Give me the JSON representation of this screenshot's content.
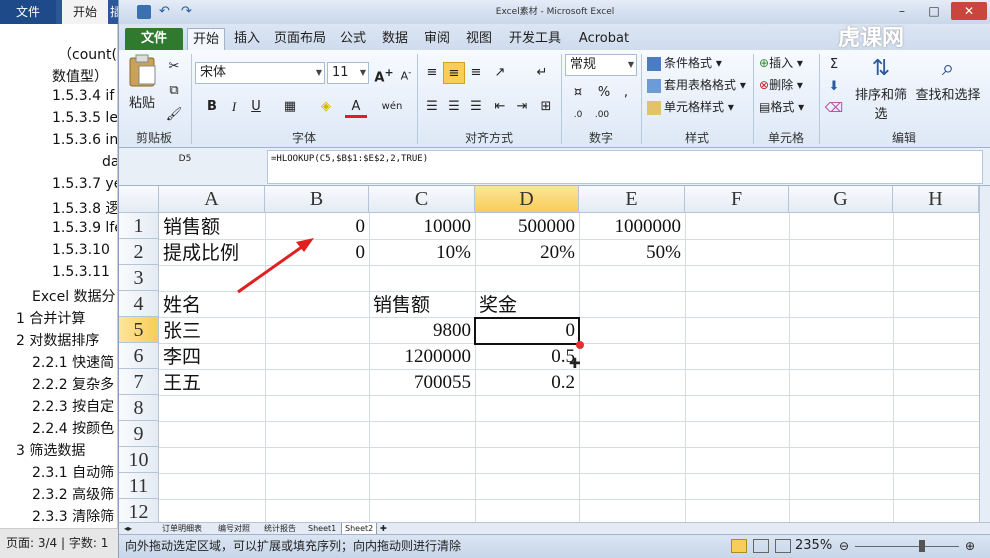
{
  "word": {
    "tabs": [
      "文件",
      "开始",
      "插"
    ],
    "nav": [
      "（count(",
      "数值型）",
      "1.5.3.4 if",
      "1.5.3.5 le",
      "1.5.3.6 in",
      "da",
      "1.5.3.7 ye",
      "1.5.3.8 逻",
      "1.5.3.9 lfe",
      "1.5.3.10",
      "1.5.3.11",
      "Excel 数据分",
      "1    合并计算",
      "2    对数据排序",
      "2.2.1 快速简",
      "2.2.2 复杂多",
      "2.2.3 按自定",
      "2.2.4 按颜色",
      "3    筛选数据",
      "2.3.1 自动筛",
      "2.3.2 高级筛",
      "2.3.3 清除筛"
    ],
    "status": "页面: 3/4 | 字数: 1"
  },
  "excel": {
    "title": "Excel素材 - Microsoft Excel",
    "tabs": [
      "文件",
      "开始",
      "插入",
      "页面布局",
      "公式",
      "数据",
      "审阅",
      "视图",
      "开发工具",
      "Acrobat"
    ],
    "ribbon": {
      "paste": "粘贴",
      "clipboard": "剪贴板",
      "font_name": "宋体",
      "font_size": "11",
      "font_group": "字体",
      "align_group": "对齐方式",
      "number_format": "常规",
      "number_group": "数字",
      "cond_format": "条件格式",
      "table_format": "套用表格格式",
      "cell_style": "单元格样式",
      "style_group": "样式",
      "insert": "插入",
      "delete": "删除",
      "format": "格式",
      "cells_group": "单元格",
      "sort_filter": "排序和筛选",
      "find_select": "查找和选择",
      "edit_group": "编辑",
      "bold": "B",
      "italic": "I",
      "underline": "U",
      "font_a": "A"
    },
    "formula_bar": {
      "name_box": "D5",
      "formula": "=HLOOKUP(C5,$B$1:$E$2,2,TRUE)"
    },
    "columns": [
      "A",
      "B",
      "C",
      "D",
      "E",
      "F",
      "G",
      "H"
    ],
    "rows": [
      "1",
      "2",
      "3",
      "4",
      "5",
      "6",
      "7",
      "8",
      "9",
      "10",
      "11",
      "12"
    ],
    "cells": {
      "A1": "销售额",
      "B1": "0",
      "C1": "10000",
      "D1": "500000",
      "E1": "1000000",
      "A2": "提成比例",
      "B2": "0",
      "C2": "10%",
      "D2": "20%",
      "E2": "50%",
      "A4": "姓名",
      "C4": "销售额",
      "D4": "奖金",
      "A5": "张三",
      "C5": "9800",
      "D5": "0",
      "A6": "李四",
      "C6": "1200000",
      "D6": "0.5",
      "A7": "王五",
      "C7": "700055",
      "D7": "0.2"
    },
    "sheet_tabs": [
      "订单明细表",
      "编号对照",
      "统计报告",
      "Sheet1",
      "Sheet2"
    ],
    "active_sheet": "Sheet2",
    "status_message": "向外拖动选定区域，可以扩展或填充序列；向内拖动则进行清除",
    "zoom": "235%",
    "colors": {
      "file_tab": "#2f7a2f",
      "selection_header": "#f8cd58",
      "arrow": "#e02020"
    }
  }
}
